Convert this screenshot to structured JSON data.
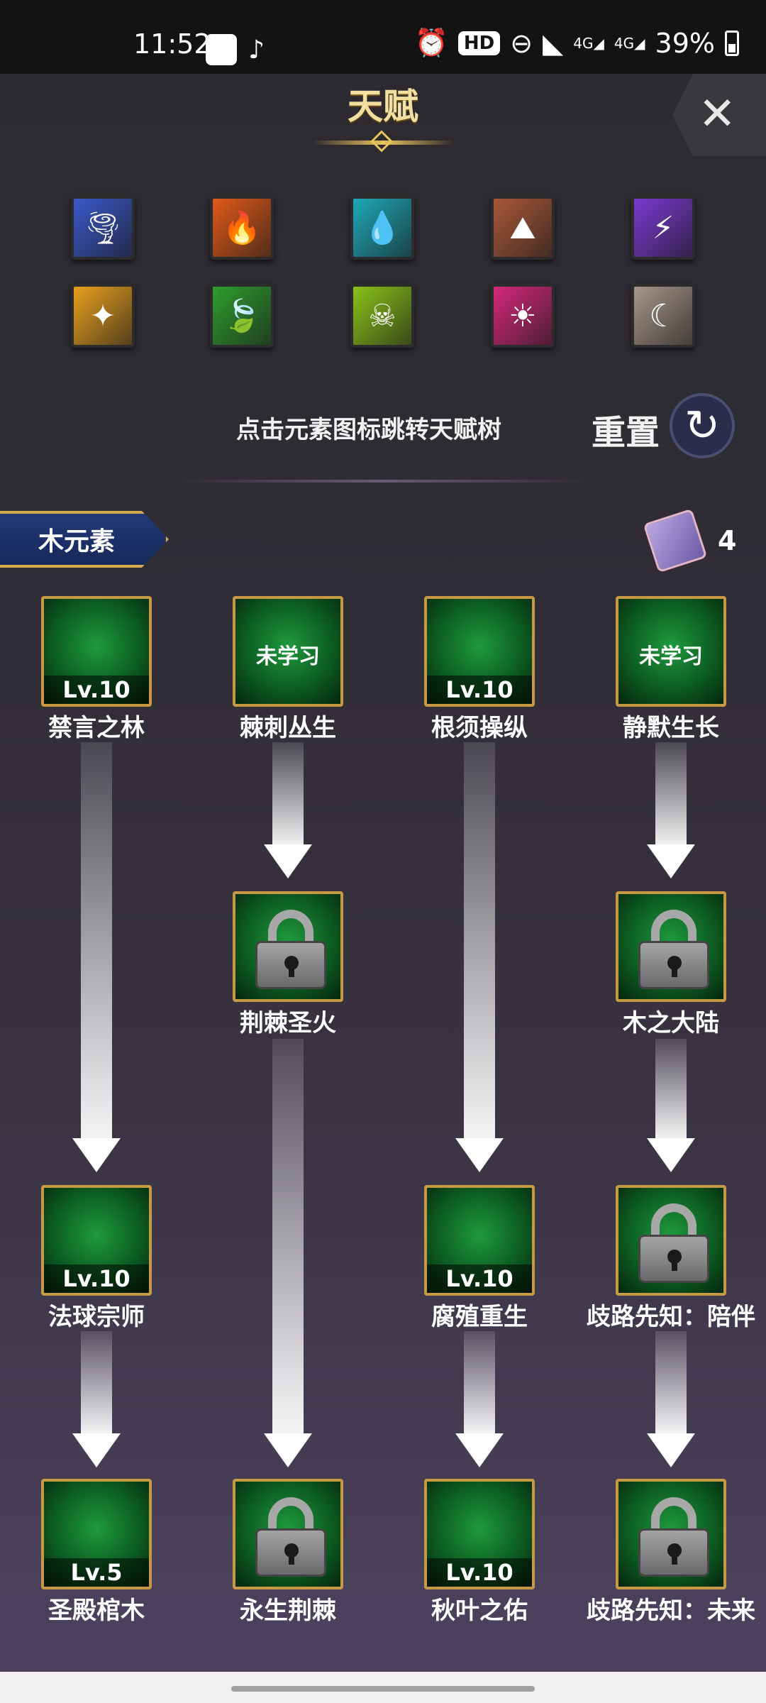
{
  "status_bar": {
    "time": "11:52",
    "signal_1": "4G",
    "signal_2": "4G",
    "battery": "39%",
    "hd_label": "HD"
  },
  "header": {
    "title": "天赋",
    "close_icon": "close-icon"
  },
  "elements": [
    {
      "name": "wind-element-icon",
      "color": "#3b58c8",
      "glyph": "🌪"
    },
    {
      "name": "fire-element-icon",
      "color": "#e05a1a",
      "glyph": "🔥"
    },
    {
      "name": "water-element-icon",
      "color": "#1fa9b8",
      "glyph": "💧"
    },
    {
      "name": "earth-element-icon",
      "color": "#a9583a",
      "glyph": "⛰"
    },
    {
      "name": "thunder-element-icon",
      "color": "#7a3ad0",
      "glyph": "⚡"
    },
    {
      "name": "light-element-icon",
      "color": "#e8a01e",
      "glyph": "✦"
    },
    {
      "name": "wood-element-icon",
      "color": "#2f9c2f",
      "glyph": "🍃"
    },
    {
      "name": "poison-element-icon",
      "color": "#8ac21a",
      "glyph": "☠"
    },
    {
      "name": "sun-element-icon",
      "color": "#d4287a",
      "glyph": "☀"
    },
    {
      "name": "moon-element-icon",
      "color": "#a8968a",
      "glyph": "☾"
    }
  ],
  "hint_text": "点击元素图标跳转天赋树",
  "reset": {
    "label": "重置",
    "icon": "redo-icon"
  },
  "tab": {
    "label": "木元素"
  },
  "scroll": {
    "icon": "talent-scroll-icon",
    "count": "4"
  },
  "nodes": [
    {
      "id": "n1",
      "name": "禁言之林",
      "level": "Lv.10",
      "locked": false
    },
    {
      "id": "n2",
      "name": "棘刺丛生",
      "unlearned": "未学习",
      "locked": false
    },
    {
      "id": "n3",
      "name": "根须操纵",
      "level": "Lv.10",
      "locked": false
    },
    {
      "id": "n4",
      "name": "静默生长",
      "unlearned": "未学习",
      "locked": false
    },
    {
      "id": "n5",
      "name": "荆棘圣火",
      "locked": true
    },
    {
      "id": "n6",
      "name": "木之大陆",
      "locked": true
    },
    {
      "id": "n7",
      "name": "法球宗师",
      "level": "Lv.10",
      "locked": false
    },
    {
      "id": "n8",
      "name": "腐殖重生",
      "level": "Lv.10",
      "locked": false
    },
    {
      "id": "n9",
      "name": "歧路先知：陪伴",
      "locked": true
    },
    {
      "id": "n10",
      "name": "圣殿棺木",
      "level": "Lv.5",
      "locked": false
    },
    {
      "id": "n11",
      "name": "永生荆棘",
      "locked": true
    },
    {
      "id": "n12",
      "name": "秋叶之佑",
      "level": "Lv.10",
      "locked": false
    },
    {
      "id": "n13",
      "name": "歧路先知：未来",
      "locked": true
    }
  ]
}
